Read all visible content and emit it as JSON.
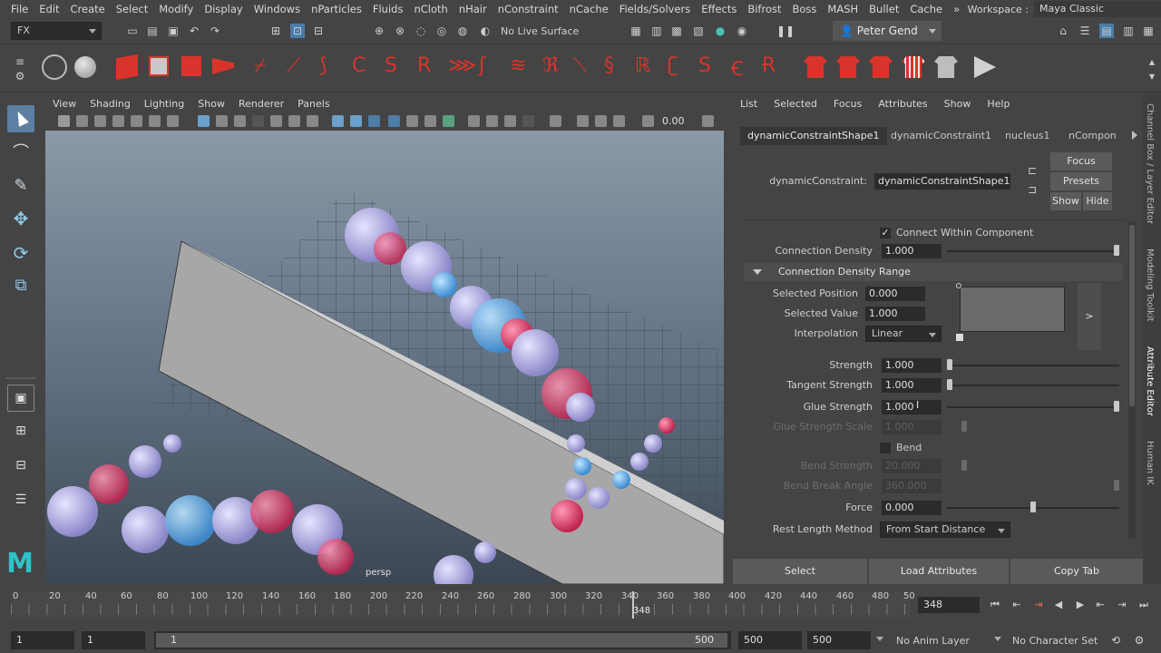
{
  "menubar": {
    "items": [
      "File",
      "Edit",
      "Create",
      "Select",
      "Modify",
      "Display",
      "Windows",
      "nParticles",
      "Fluids",
      "nCloth",
      "nHair",
      "nConstraint",
      "nCache",
      "Fields/Solvers",
      "Effects",
      "Bifrost",
      "Boss",
      "MASH",
      "Bullet",
      "Cache"
    ],
    "overflow": "»",
    "workspace_label": "Workspace :",
    "workspace_value": "Maya Classic"
  },
  "status": {
    "mode": "FX",
    "live_surface": "No Live Surface",
    "user": "Peter Gend"
  },
  "viewport": {
    "menu": [
      "View",
      "Shading",
      "Lighting",
      "Show",
      "Renderer",
      "Panels"
    ],
    "exposure_value": "0.00",
    "camera_label": "persp"
  },
  "attribute_editor": {
    "menu": [
      "List",
      "Selected",
      "Focus",
      "Attributes",
      "Show",
      "Help"
    ],
    "tabs": [
      "dynamicConstraintShape1",
      "dynamicConstraint1",
      "nucleus1",
      "nCompon"
    ],
    "node_label": "dynamicConstraint:",
    "node_value": "dynamicConstraintShape1",
    "buttons": {
      "focus": "Focus",
      "presets": "Presets",
      "show": "Show",
      "hide": "Hide"
    },
    "connect_within_component": "Connect Within Component",
    "connection_density": {
      "label": "Connection Density",
      "value": "1.000"
    },
    "density_range_section": "Connection Density Range",
    "selected_position": {
      "label": "Selected Position",
      "value": "0.000"
    },
    "selected_value": {
      "label": "Selected Value",
      "value": "1.000"
    },
    "interpolation": {
      "label": "Interpolation",
      "value": "Linear"
    },
    "ramp_expand": ">",
    "strength": {
      "label": "Strength",
      "value": "1.000"
    },
    "tangent_strength": {
      "label": "Tangent Strength",
      "value": "1.000"
    },
    "glue_strength": {
      "label": "Glue Strength",
      "value": "1.000"
    },
    "glue_strength_scale": {
      "label": "Glue Strength Scale",
      "value": "1.000"
    },
    "bend": "Bend",
    "bend_strength": {
      "label": "Bend Strength",
      "value": "20.000"
    },
    "bend_break_angle": {
      "label": "Bend Break Angle",
      "value": "360.000"
    },
    "force": {
      "label": "Force",
      "value": "0.000"
    },
    "rest_length_method": {
      "label": "Rest Length Method",
      "value": "From Start Distance"
    },
    "bottom_buttons": [
      "Select",
      "Load Attributes",
      "Copy Tab"
    ]
  },
  "side_tabs": [
    "Channel Box / Layer Editor",
    "Modeling Toolkit",
    "Attribute Editor",
    "Human IK"
  ],
  "timeline": {
    "ticks": [
      "0",
      "20",
      "40",
      "60",
      "80",
      "100",
      "120",
      "140",
      "160",
      "180",
      "200",
      "220",
      "240",
      "260",
      "280",
      "300",
      "320",
      "340",
      "360",
      "380",
      "400",
      "420",
      "440",
      "460",
      "480",
      "50"
    ],
    "current_frame_marker": "348",
    "current_frame": "348"
  },
  "range": {
    "start": "1",
    "anim_start": "1",
    "range_start_label": "1",
    "range_end_label": "500",
    "anim_end": "500",
    "end": "500",
    "anim_layer": "No Anim Layer",
    "character_set": "No Character Set"
  },
  "colors": {
    "maya_logo": "#2fc2c9",
    "shelf_red": "#d9342b",
    "accent_blue": "#4a90c8"
  }
}
